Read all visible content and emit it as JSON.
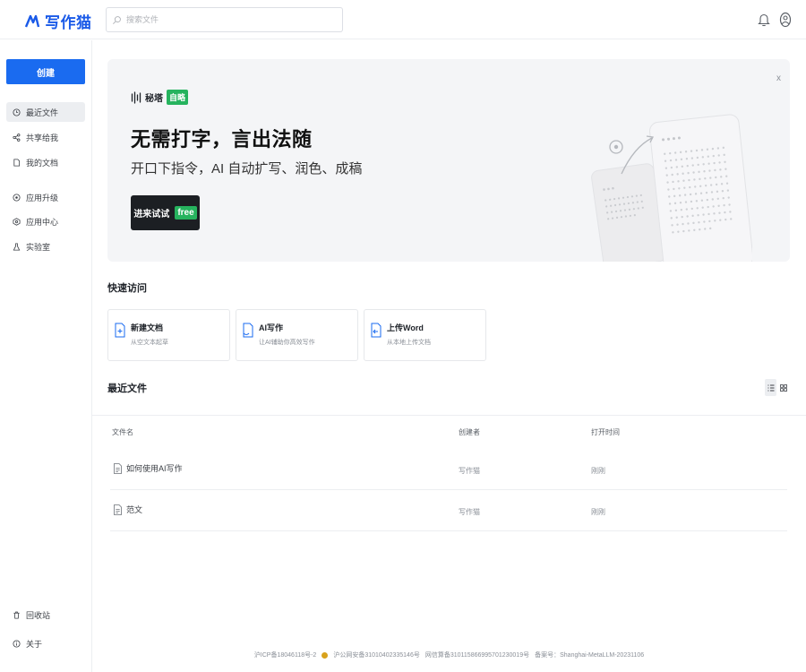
{
  "header": {
    "logo_text": "写作猫",
    "search_placeholder": "搜索文件"
  },
  "sidebar": {
    "create_label": "创建",
    "items": [
      {
        "label": "最近文件",
        "icon": "clock-icon",
        "active": true
      },
      {
        "label": "共享给我",
        "icon": "share-icon"
      },
      {
        "label": "我的文档",
        "icon": "document-icon"
      },
      {
        "label": "应用升级",
        "icon": "upgrade-icon"
      },
      {
        "label": "应用中心",
        "icon": "app-center-icon"
      },
      {
        "label": "实验室",
        "icon": "flask-icon"
      }
    ],
    "bottom": [
      {
        "label": "回收站",
        "icon": "trash-icon"
      },
      {
        "label": "关于",
        "icon": "info-icon"
      }
    ]
  },
  "banner": {
    "brand_name": "秘塔",
    "brand_tag": "自略",
    "title": "无需打字，言出法随",
    "subtitle": "开口下指令，AI 自动扩写、润色、成稿",
    "button_label": "进来试试",
    "button_tag": "free",
    "close_label": "x"
  },
  "quick_access": {
    "title": "快速访问",
    "cards": [
      {
        "title": "新建文档",
        "desc": "从空文本起草",
        "icon": "new-doc-icon"
      },
      {
        "title": "AI写作",
        "desc": "让AI辅助你高效写作",
        "icon": "ai-write-icon"
      },
      {
        "title": "上传Word",
        "desc": "从本地上传文档",
        "icon": "upload-word-icon"
      }
    ]
  },
  "recent": {
    "title": "最近文件",
    "columns": {
      "name": "文件名",
      "creator": "创建者",
      "opened": "打开时间"
    },
    "rows": [
      {
        "name": "如何使用AI写作",
        "creator": "写作猫",
        "opened": "刚刚"
      },
      {
        "name": "范文",
        "creator": "写作猫",
        "opened": "刚刚"
      }
    ]
  },
  "footer": {
    "icp": "沪ICP备18046118号-2",
    "police": "沪公网安备31010402335146号",
    "netinfo": "网信算备310115866995701230019号",
    "filing": "备案号：Shanghai-MetaLLM-20231106"
  },
  "colors": {
    "accent": "#1a6bf0",
    "green_tag": "#26b35e",
    "dark_button": "#1c1f23"
  }
}
